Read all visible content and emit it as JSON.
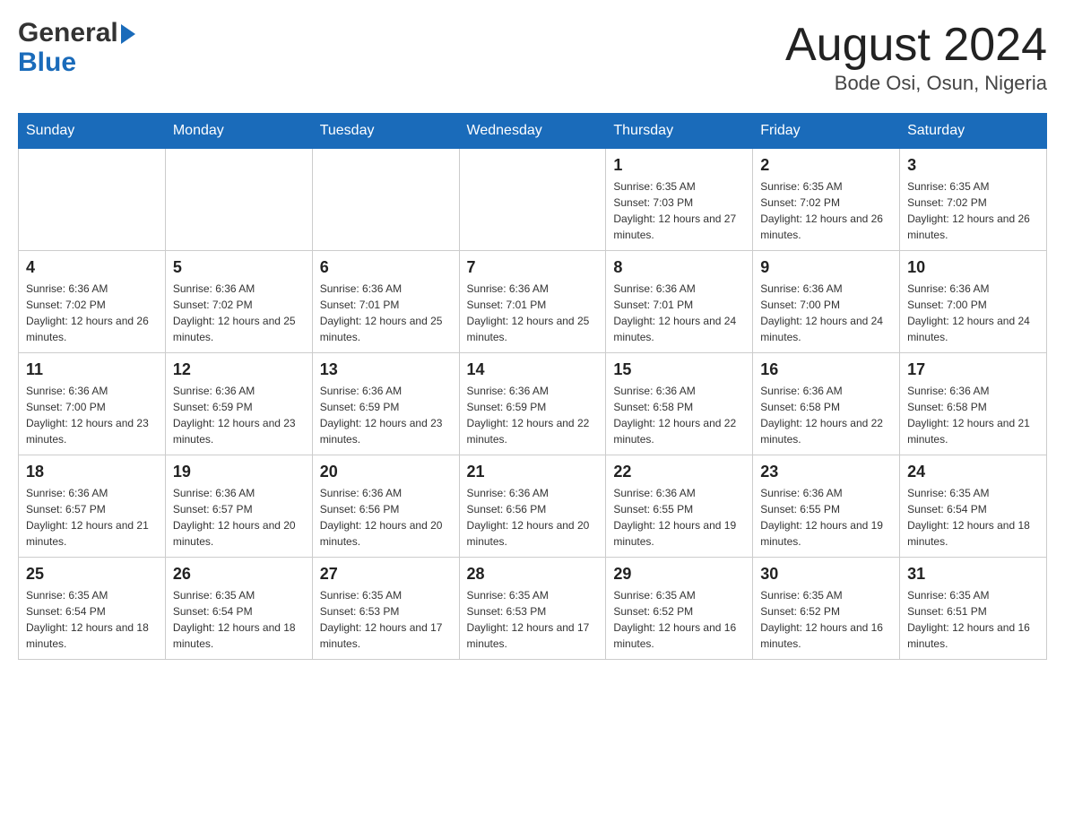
{
  "header": {
    "logo": {
      "general": "General",
      "blue": "Blue"
    },
    "title": "August 2024",
    "subtitle": "Bode Osi, Osun, Nigeria"
  },
  "days_of_week": [
    "Sunday",
    "Monday",
    "Tuesday",
    "Wednesday",
    "Thursday",
    "Friday",
    "Saturday"
  ],
  "weeks": [
    [
      {
        "day": "",
        "info": ""
      },
      {
        "day": "",
        "info": ""
      },
      {
        "day": "",
        "info": ""
      },
      {
        "day": "",
        "info": ""
      },
      {
        "day": "1",
        "info": "Sunrise: 6:35 AM\nSunset: 7:03 PM\nDaylight: 12 hours and 27 minutes."
      },
      {
        "day": "2",
        "info": "Sunrise: 6:35 AM\nSunset: 7:02 PM\nDaylight: 12 hours and 26 minutes."
      },
      {
        "day": "3",
        "info": "Sunrise: 6:35 AM\nSunset: 7:02 PM\nDaylight: 12 hours and 26 minutes."
      }
    ],
    [
      {
        "day": "4",
        "info": "Sunrise: 6:36 AM\nSunset: 7:02 PM\nDaylight: 12 hours and 26 minutes."
      },
      {
        "day": "5",
        "info": "Sunrise: 6:36 AM\nSunset: 7:02 PM\nDaylight: 12 hours and 25 minutes."
      },
      {
        "day": "6",
        "info": "Sunrise: 6:36 AM\nSunset: 7:01 PM\nDaylight: 12 hours and 25 minutes."
      },
      {
        "day": "7",
        "info": "Sunrise: 6:36 AM\nSunset: 7:01 PM\nDaylight: 12 hours and 25 minutes."
      },
      {
        "day": "8",
        "info": "Sunrise: 6:36 AM\nSunset: 7:01 PM\nDaylight: 12 hours and 24 minutes."
      },
      {
        "day": "9",
        "info": "Sunrise: 6:36 AM\nSunset: 7:00 PM\nDaylight: 12 hours and 24 minutes."
      },
      {
        "day": "10",
        "info": "Sunrise: 6:36 AM\nSunset: 7:00 PM\nDaylight: 12 hours and 24 minutes."
      }
    ],
    [
      {
        "day": "11",
        "info": "Sunrise: 6:36 AM\nSunset: 7:00 PM\nDaylight: 12 hours and 23 minutes."
      },
      {
        "day": "12",
        "info": "Sunrise: 6:36 AM\nSunset: 6:59 PM\nDaylight: 12 hours and 23 minutes."
      },
      {
        "day": "13",
        "info": "Sunrise: 6:36 AM\nSunset: 6:59 PM\nDaylight: 12 hours and 23 minutes."
      },
      {
        "day": "14",
        "info": "Sunrise: 6:36 AM\nSunset: 6:59 PM\nDaylight: 12 hours and 22 minutes."
      },
      {
        "day": "15",
        "info": "Sunrise: 6:36 AM\nSunset: 6:58 PM\nDaylight: 12 hours and 22 minutes."
      },
      {
        "day": "16",
        "info": "Sunrise: 6:36 AM\nSunset: 6:58 PM\nDaylight: 12 hours and 22 minutes."
      },
      {
        "day": "17",
        "info": "Sunrise: 6:36 AM\nSunset: 6:58 PM\nDaylight: 12 hours and 21 minutes."
      }
    ],
    [
      {
        "day": "18",
        "info": "Sunrise: 6:36 AM\nSunset: 6:57 PM\nDaylight: 12 hours and 21 minutes."
      },
      {
        "day": "19",
        "info": "Sunrise: 6:36 AM\nSunset: 6:57 PM\nDaylight: 12 hours and 20 minutes."
      },
      {
        "day": "20",
        "info": "Sunrise: 6:36 AM\nSunset: 6:56 PM\nDaylight: 12 hours and 20 minutes."
      },
      {
        "day": "21",
        "info": "Sunrise: 6:36 AM\nSunset: 6:56 PM\nDaylight: 12 hours and 20 minutes."
      },
      {
        "day": "22",
        "info": "Sunrise: 6:36 AM\nSunset: 6:55 PM\nDaylight: 12 hours and 19 minutes."
      },
      {
        "day": "23",
        "info": "Sunrise: 6:36 AM\nSunset: 6:55 PM\nDaylight: 12 hours and 19 minutes."
      },
      {
        "day": "24",
        "info": "Sunrise: 6:35 AM\nSunset: 6:54 PM\nDaylight: 12 hours and 18 minutes."
      }
    ],
    [
      {
        "day": "25",
        "info": "Sunrise: 6:35 AM\nSunset: 6:54 PM\nDaylight: 12 hours and 18 minutes."
      },
      {
        "day": "26",
        "info": "Sunrise: 6:35 AM\nSunset: 6:54 PM\nDaylight: 12 hours and 18 minutes."
      },
      {
        "day": "27",
        "info": "Sunrise: 6:35 AM\nSunset: 6:53 PM\nDaylight: 12 hours and 17 minutes."
      },
      {
        "day": "28",
        "info": "Sunrise: 6:35 AM\nSunset: 6:53 PM\nDaylight: 12 hours and 17 minutes."
      },
      {
        "day": "29",
        "info": "Sunrise: 6:35 AM\nSunset: 6:52 PM\nDaylight: 12 hours and 16 minutes."
      },
      {
        "day": "30",
        "info": "Sunrise: 6:35 AM\nSunset: 6:52 PM\nDaylight: 12 hours and 16 minutes."
      },
      {
        "day": "31",
        "info": "Sunrise: 6:35 AM\nSunset: 6:51 PM\nDaylight: 12 hours and 16 minutes."
      }
    ]
  ]
}
